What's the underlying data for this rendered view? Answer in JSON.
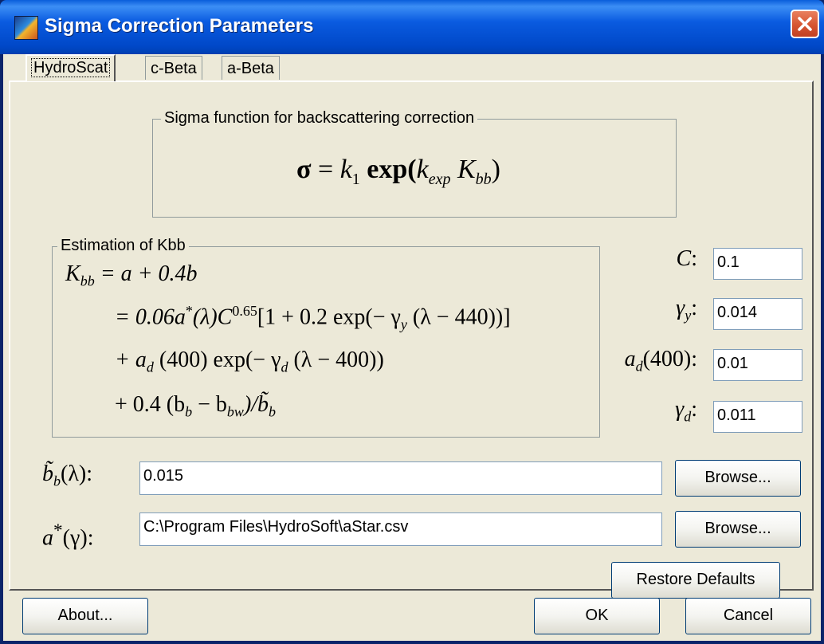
{
  "window": {
    "title": "Sigma Correction Parameters"
  },
  "tabs": [
    "HydroScat",
    "c-Beta",
    "a-Beta"
  ],
  "sigma_group": {
    "title": "Sigma function for backscattering correction",
    "equation": {
      "sigma": "σ",
      "eq": " = ",
      "k": "k",
      "k_sub": "1",
      "exp": " exp(",
      "kexp": "k",
      "kexp_sub": "exp",
      "K": " K",
      "K_sub": "bb",
      "close": ")"
    }
  },
  "kbb_group": {
    "title": "Estimation of Kbb",
    "line1": {
      "K": "K",
      "K_sub": "bb",
      "rest": " = a + 0.4b"
    },
    "line2": {
      "a": "= 0.06a",
      "star": "*",
      "mid": "(λ)C",
      "pow": "0.65",
      "bracket": "[1 + 0.2 exp(− γ",
      "gsub": "y",
      "end": " (λ − 440))]"
    },
    "line3": {
      "a": "+ a",
      "asub": "d",
      "mid": " (400) exp(− γ",
      "gsub": "d",
      "end": " (λ − 400))"
    },
    "line4": {
      "a": "+ 0.4 (b",
      "bsub": "b",
      "mid": " − b",
      "bwsub": "bw",
      "end": ")/b̃",
      "bsub2": "b"
    }
  },
  "params": [
    {
      "label": "C",
      "sub": "",
      "tail": ":",
      "value": "0.1"
    },
    {
      "label": "γ",
      "sub": "y",
      "tail": ":",
      "value": "0.014"
    },
    {
      "label": "a",
      "sub": "d",
      "tail": "(400):",
      "value": "0.01"
    },
    {
      "label": "γ",
      "sub": "d",
      "tail": ":",
      "value": "0.011"
    }
  ],
  "bb_field": {
    "label": "b̃",
    "sub": "b",
    "tail": "(λ):",
    "value": "0.015",
    "browse": "Browse..."
  },
  "astar_field": {
    "label": "a",
    "sup": "*",
    "tail": "(γ):",
    "value": "C:\\Program Files\\HydroSoft\\aStar.csv",
    "browse": "Browse..."
  },
  "buttons": {
    "restore": "Restore Defaults",
    "about": "About...",
    "ok": "OK",
    "cancel": "Cancel"
  }
}
